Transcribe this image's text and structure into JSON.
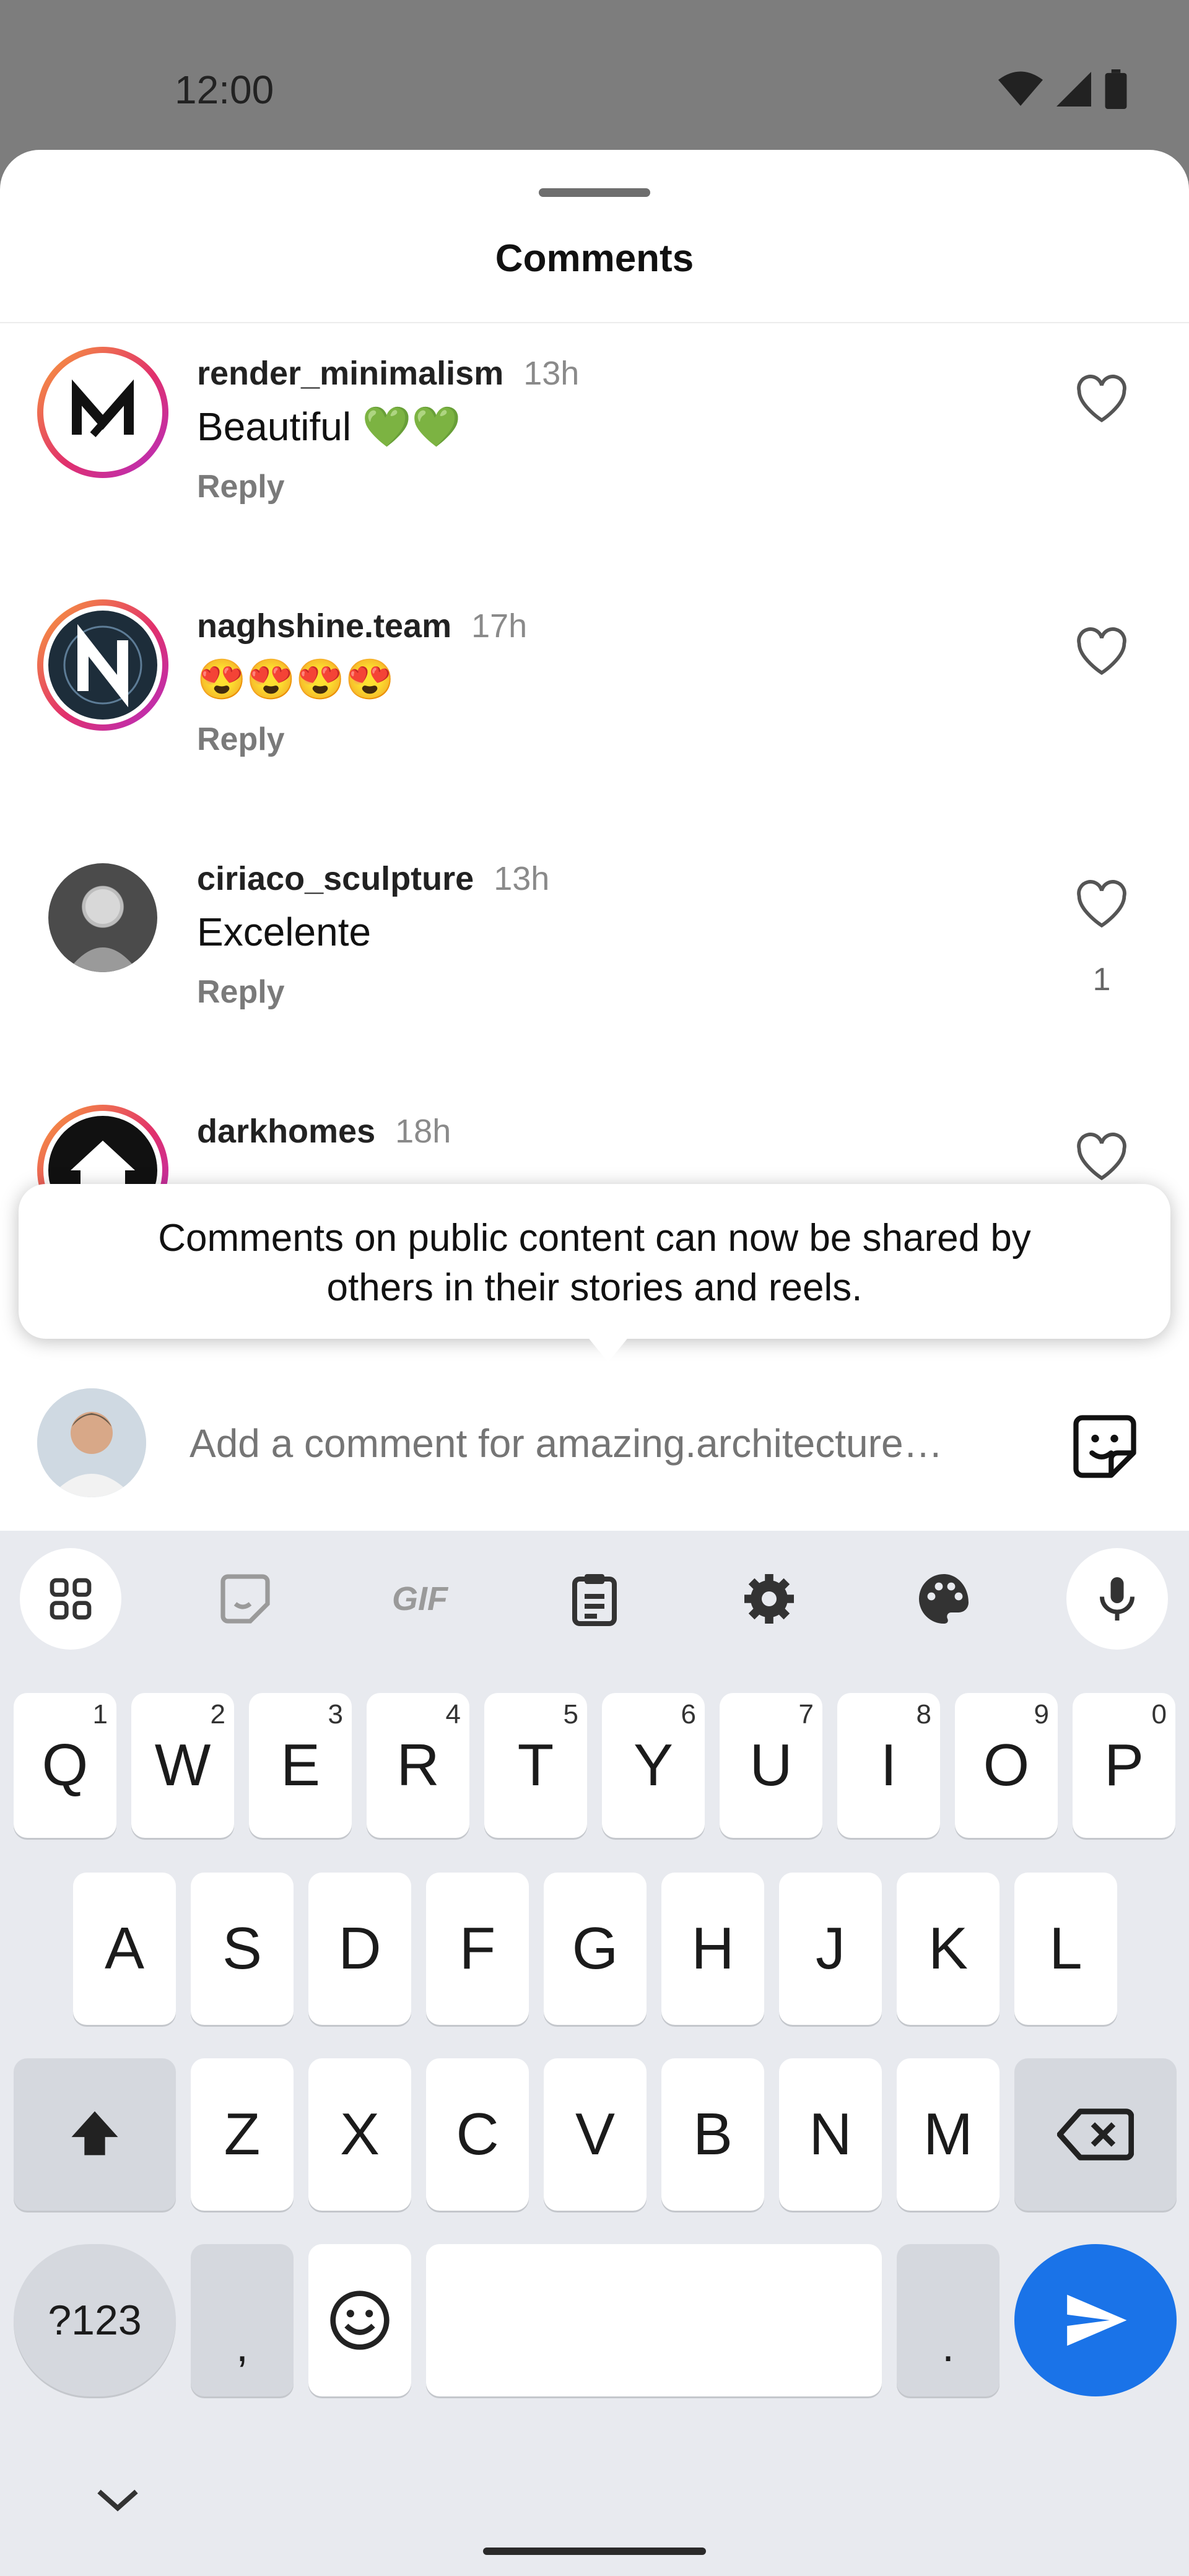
{
  "status_bar": {
    "time": "12:00"
  },
  "sheet": {
    "title": "Comments"
  },
  "comments": [
    {
      "username": "render_minimalism",
      "time": "13h",
      "text": "Beautiful 💚💚",
      "reply_label": "Reply",
      "likes": ""
    },
    {
      "username": "naghshine.team",
      "time": "17h",
      "text": "😍😍😍😍",
      "reply_label": "Reply",
      "likes": ""
    },
    {
      "username": "ciriaco_sculpture",
      "time": "13h",
      "text": "Excelente",
      "reply_label": "Reply",
      "likes": "1"
    },
    {
      "username": "darkhomes",
      "time": "18h",
      "text": "",
      "reply_label": "",
      "likes": ""
    }
  ],
  "tooltip": {
    "text": "Comments on public content can now be shared by others in their stories and reels."
  },
  "composer": {
    "placeholder": "Add a comment for amazing.architecture…"
  },
  "keyboard": {
    "toolbar": [
      "apps-grid-icon",
      "sticker-icon",
      "gif-icon",
      "clipboard-icon",
      "settings-icon",
      "palette-icon",
      "mic-icon"
    ],
    "gif_label": "GIF",
    "row1": [
      "Q",
      "W",
      "E",
      "R",
      "T",
      "Y",
      "U",
      "I",
      "O",
      "P"
    ],
    "row1_hints": [
      "1",
      "2",
      "3",
      "4",
      "5",
      "6",
      "7",
      "8",
      "9",
      "0"
    ],
    "row2": [
      "A",
      "S",
      "D",
      "F",
      "G",
      "H",
      "J",
      "K",
      "L"
    ],
    "row3": [
      "Z",
      "X",
      "C",
      "V",
      "B",
      "N",
      "M"
    ],
    "symbols_label": "?123",
    "comma": ",",
    "period": "."
  },
  "colors": {
    "accent": "#1a73e8",
    "ring_start": "#f9a13a",
    "ring_end": "#b22dc6"
  }
}
